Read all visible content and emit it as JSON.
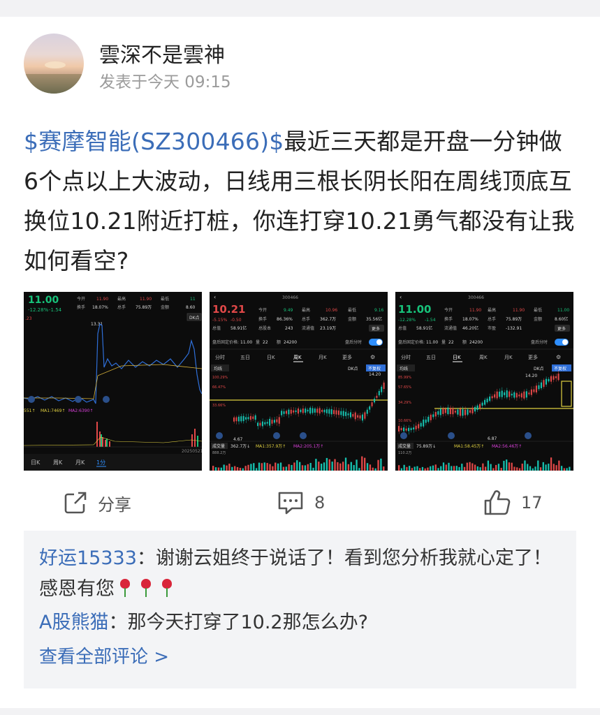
{
  "post": {
    "username": "雲深不是雲神",
    "time": "发表于今天 09:15",
    "stock_link": "$赛摩智能(SZ300466)$",
    "body": "最近三天都是开盘一分钟做6个点以上大波动，日线用三根长阴长阳在周线顶底互换位10.21附近打桩，你连打穿10.21勇气都没有让我如何看空?"
  },
  "thumb1": {
    "price": "11.00",
    "change": "-12.28%",
    "change_abs": "-1.54",
    "open_label": "今开",
    "open_val": "11.90",
    "high_label": "最高",
    "high_val": "11.90",
    "low_label": "最低",
    "low_val": "11",
    "turnover_label": "换手",
    "turnover_val": "18.07%",
    "volume_label": "总手",
    "volume_val": "75.89万",
    "amount_label": "金额",
    "amount_val": "8.60",
    "peak": "13.31",
    "ma1": "MA1:7469↑",
    "ma2": "MA2:6390↑",
    "ma_left": "551↑",
    "date": "20250521",
    "tabs": [
      "日K",
      "周K",
      "月K",
      "1分"
    ],
    "dk": "DK点",
    "side_price": ".23"
  },
  "thumb2": {
    "price": "10.21",
    "code": "300466",
    "change": "-5.15%",
    "change_abs": "-0.50",
    "open_label": "今开",
    "open_val": "9.49",
    "high_label": "最高",
    "high_val": "10.96",
    "low_label": "最低",
    "low_val": "9.16",
    "turnover_label": "换手",
    "turnover_val": "86.36%",
    "volume_label": "总手",
    "volume_val": "362.7万",
    "amount_label": "金额",
    "amount_val": "35.56亿",
    "mcap_label": "总值",
    "mcap_val": "58.91亿",
    "pe_label": "总股本",
    "pe_val": "243",
    "float_label": "流通值",
    "float_val": "23.19万",
    "more": "更多",
    "after_label": "盘后固定价格:",
    "after_price": "11.00",
    "after_vol_label": "量",
    "after_vol": "22",
    "after_amt_label": "额",
    "after_amt": "24200",
    "after_toggle": "盘后分时",
    "tabs": [
      "分时",
      "五日",
      "日K",
      "周K",
      "月K",
      "更多"
    ],
    "indicator": "均线",
    "dk": "DK点",
    "fq": "不复权",
    "pct1": "100.29%",
    "pct2": "66.47%",
    "pct3": "33.66%",
    "peak": "14.20",
    "low_mark": "4.67",
    "vol_label": "成交量",
    "vol_val": "362.7万↓",
    "vol_ma1": "MA1:357.9万↑",
    "vol_ma2": "MA2:205.1万↑",
    "vol_scale": "888.2万"
  },
  "thumb3": {
    "price": "11.00",
    "code": "300466",
    "change": "-12.28%",
    "change_abs": "-1.54",
    "open_label": "今开",
    "open_val": "11.90",
    "high_label": "最高",
    "high_val": "11.90",
    "low_label": "最低",
    "low_val": "11.00",
    "turnover_label": "换手",
    "turnover_val": "18.07%",
    "volume_label": "总手",
    "volume_val": "75.89万",
    "amount_label": "金额",
    "amount_val": "8.60亿",
    "mcap_label": "总值",
    "mcap_val": "58.91亿",
    "float_label": "流通值",
    "float_val": "46.20亿",
    "pe_label": "市盈",
    "pe_val": "-132.91",
    "more": "更多",
    "after_label": "盘后固定价格:",
    "after_price": "11.00",
    "after_vol_label": "量",
    "after_vol": "22",
    "after_amt_label": "额",
    "after_amt": "24200",
    "after_toggle": "盘后分时",
    "tabs": [
      "分时",
      "五日",
      "日K",
      "周K",
      "月K",
      "更多"
    ],
    "indicator": "均线",
    "dk": "DK点",
    "fq": "不复权",
    "pct1": "85.99%",
    "pct2": "57.65%",
    "pct3": "34.29%",
    "pct4": "10.66%",
    "peak": "14.20",
    "low_mark": "6.87",
    "vol_label": "成交量",
    "vol_val": "75.89万↓",
    "vol_ma1": "MA1:58.45万↑",
    "vol_ma2": "MA2:56.46万↑",
    "vol_scale": "110.2万"
  },
  "actions": {
    "share_label": "分享",
    "comment_count": "8",
    "like_count": "17"
  },
  "comments": [
    {
      "author": "好运15333",
      "sep": "：",
      "text": "谢谢云姐终于说话了！看到您分析我就心定了！感恩有您"
    },
    {
      "author": "A股熊猫",
      "sep": "：",
      "text": "那今天打穿了10.2那怎么办?"
    }
  ],
  "view_all": "查看全部评论 >"
}
